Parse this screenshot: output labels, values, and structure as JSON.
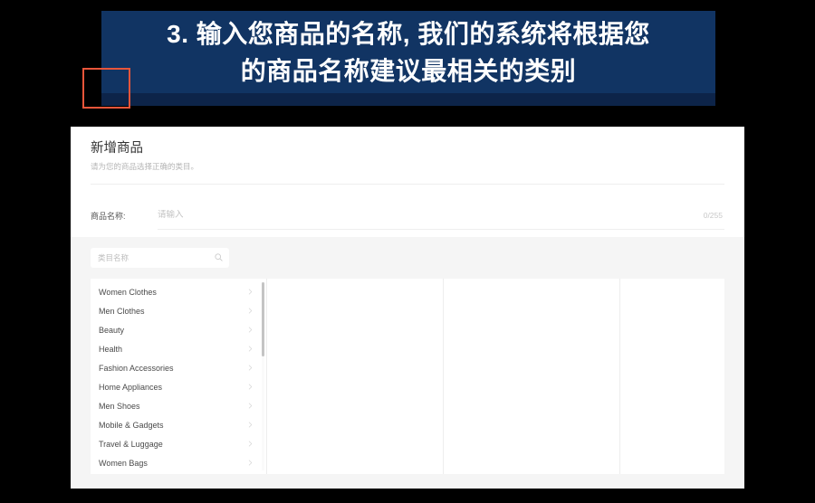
{
  "banner": {
    "line1": "3. 输入您商品的名称, 我们的系统将根据您",
    "line2": "的商品名称建议最相关的类别",
    "background_color": "#113463",
    "shadow_color": "#0d2449",
    "text_color": "#ffffff"
  },
  "panel": {
    "title": "新增商品",
    "subtitle": "请为您的商品选择正确的类目。"
  },
  "form": {
    "name_label": "商品名称:",
    "name_value": "",
    "name_placeholder": "请输入",
    "char_counter": "0/255",
    "highlight_color": "#e8553a"
  },
  "category_picker": {
    "search_placeholder": "类目名称",
    "search_value": "",
    "search_icon": "search-icon",
    "chevron_icon": "chevron-right-icon",
    "columns": [
      {
        "items": [
          {
            "label": "Women Clothes"
          },
          {
            "label": "Men Clothes"
          },
          {
            "label": "Beauty"
          },
          {
            "label": "Health"
          },
          {
            "label": "Fashion Accessories"
          },
          {
            "label": "Home Appliances"
          },
          {
            "label": "Men Shoes"
          },
          {
            "label": "Mobile & Gadgets"
          },
          {
            "label": "Travel & Luggage"
          },
          {
            "label": "Women Bags"
          }
        ]
      },
      {
        "items": []
      },
      {
        "items": []
      },
      {
        "items": []
      }
    ]
  }
}
